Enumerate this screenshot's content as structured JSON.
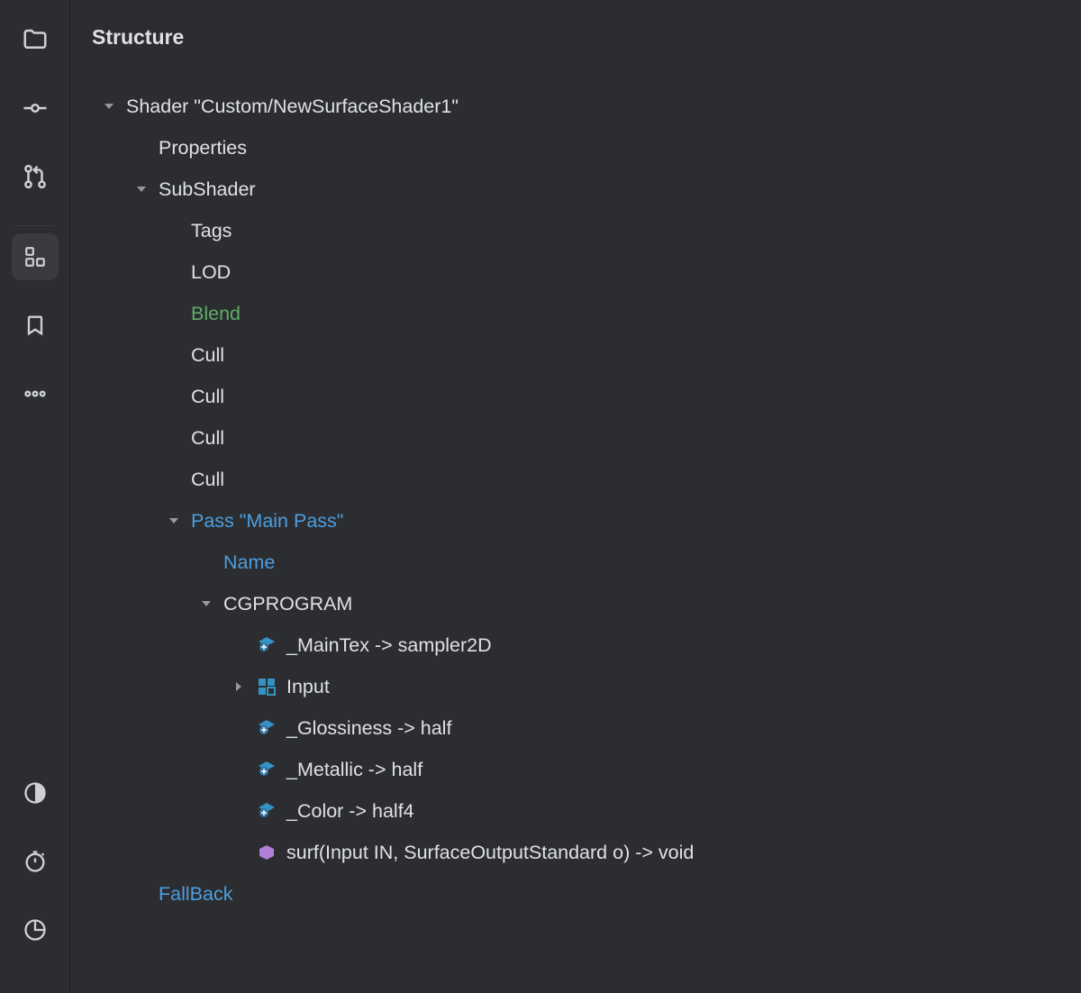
{
  "panel": {
    "title": "Structure"
  },
  "tree": {
    "l0": "Shader \"Custom/NewSurfaceShader1\"",
    "l1": "Properties",
    "l2": "SubShader",
    "l3": "Tags",
    "l4": "LOD",
    "l5": "Blend",
    "l6": "Cull",
    "l7": "Cull",
    "l8": "Cull",
    "l9": "Cull",
    "l10": "Pass \"Main Pass\"",
    "l11": "Name",
    "l12": "CGPROGRAM",
    "l13": "_MainTex -> sampler2D",
    "l14": "Input",
    "l15": "_Glossiness -> half",
    "l16": "_Metallic -> half",
    "l17": "_Color -> half4",
    "l18": "surf(Input IN, SurfaceOutputStandard o) -> void",
    "l19": "FallBack"
  },
  "icons": {
    "sidebar": [
      "project",
      "commit",
      "pull-request",
      "structure",
      "bookmark",
      "more"
    ],
    "sidebar_bottom": [
      "notifications",
      "timer",
      "analyze"
    ]
  }
}
